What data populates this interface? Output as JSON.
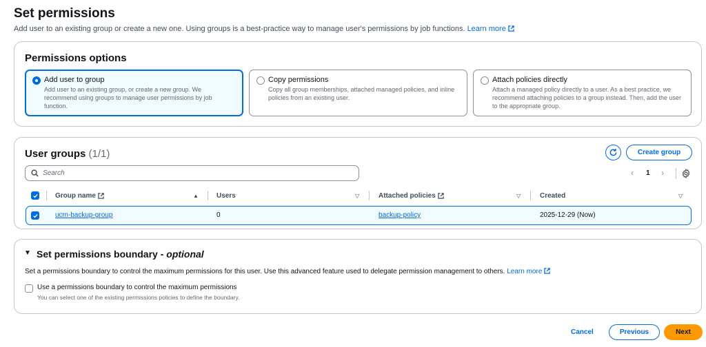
{
  "header": {
    "title": "Set permissions",
    "description": "Add user to an existing group or create a new one. Using groups is a best-practice way to manage user's permissions by job functions.",
    "learn_more": "Learn more"
  },
  "permissions_options": {
    "heading": "Permissions options",
    "options": [
      {
        "title": "Add user to group",
        "description": "Add user to an existing group, or create a new group. We recommend using groups to manage user permissions by job function.",
        "selected": true
      },
      {
        "title": "Copy permissions",
        "description": "Copy all group memberships, attached managed policies, and inline policies from an existing user.",
        "selected": false
      },
      {
        "title": "Attach policies directly",
        "description": "Attach a managed policy directly to a user. As a best practice, we recommend attaching policies to a group instead. Then, add the user to the appropriate group.",
        "selected": false
      }
    ]
  },
  "user_groups": {
    "heading": "User groups",
    "count": "(1/1)",
    "create_label": "Create group",
    "search_placeholder": "Search",
    "page": "1",
    "columns": [
      "Group name",
      "Users",
      "Attached policies",
      "Created"
    ],
    "rows": [
      {
        "group_name": "ucm-backup-group",
        "users": "0",
        "attached_policies": "backup-policy",
        "created": "2025-12-29 (Now)",
        "selected": true
      }
    ]
  },
  "boundary": {
    "title": "Set permissions boundary - ",
    "title_optional": "optional",
    "description": "Set a permissions boundary to control the maximum permissions for this user. Use this advanced feature used to delegate permission management to others.",
    "learn_more": "Learn more",
    "checkbox_label": "Use a permissions boundary to control the maximum permissions",
    "checkbox_hint": "You can select one of the existing permissions policies to define the boundary."
  },
  "footer": {
    "cancel": "Cancel",
    "previous": "Previous",
    "next": "Next"
  },
  "colors": {
    "accent": "#006ce0",
    "primary_button": "#ff9900",
    "selected_bg": "#f0fbff"
  }
}
